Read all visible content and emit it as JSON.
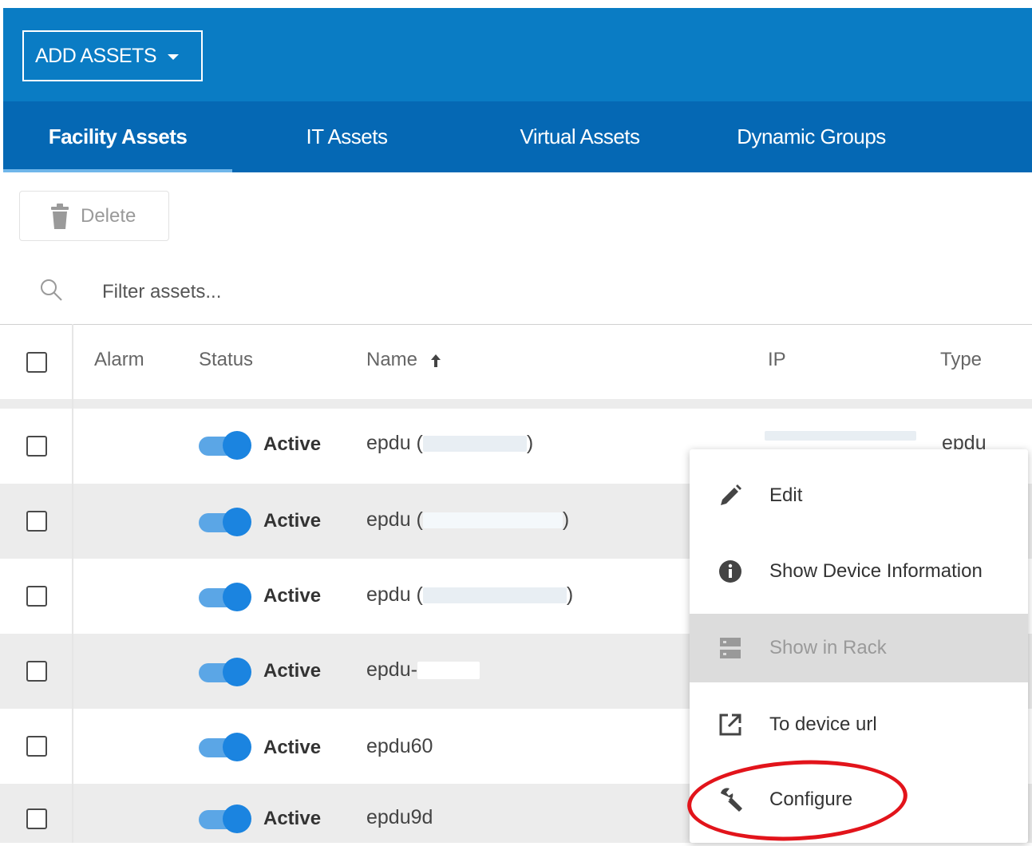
{
  "toolbar": {
    "add_assets_label": "ADD ASSETS",
    "delete_label": "Delete"
  },
  "tabs": [
    {
      "label": "Facility Assets",
      "active": true
    },
    {
      "label": "IT Assets",
      "active": false
    },
    {
      "label": "Virtual Assets",
      "active": false
    },
    {
      "label": "Dynamic Groups",
      "active": false
    }
  ],
  "search": {
    "placeholder": "Filter assets...",
    "value": ""
  },
  "table": {
    "columns": {
      "alarm": "Alarm",
      "status": "Status",
      "name": "Name",
      "ip": "IP",
      "type": "Type"
    },
    "sort": {
      "column": "name",
      "direction": "ascending",
      "icon": "arrow-up-icon"
    },
    "rows": [
      {
        "status": "Active",
        "name_prefix": "epdu (",
        "name_suffix": ")",
        "type": "epdu"
      },
      {
        "status": "Active",
        "name_prefix": "epdu (",
        "name_suffix": ")"
      },
      {
        "status": "Active",
        "name_prefix": "epdu (",
        "name_suffix": ")"
      },
      {
        "status": "Active",
        "name_prefix": "epdu-",
        "name_suffix": ""
      },
      {
        "status": "Active",
        "name_prefix": "epdu60",
        "name_suffix": ""
      },
      {
        "status": "Active",
        "name_prefix": "epdu9d",
        "name_suffix": ""
      }
    ]
  },
  "context_menu": {
    "items": [
      {
        "label": "Edit",
        "icon": "pencil-icon"
      },
      {
        "label": "Show Device Information",
        "icon": "info-icon"
      },
      {
        "label": "Show in Rack",
        "icon": "rack-icon",
        "highlighted": true,
        "disabled": true
      },
      {
        "label": "To device url",
        "icon": "external-link-icon"
      },
      {
        "label": "Configure",
        "icon": "wrench-icon"
      }
    ]
  },
  "colors": {
    "header_blue": "#0a7cc4",
    "tabs_blue": "#0568b4",
    "toggle_on": "#1b84e0",
    "annotation_red": "#e2141b"
  }
}
